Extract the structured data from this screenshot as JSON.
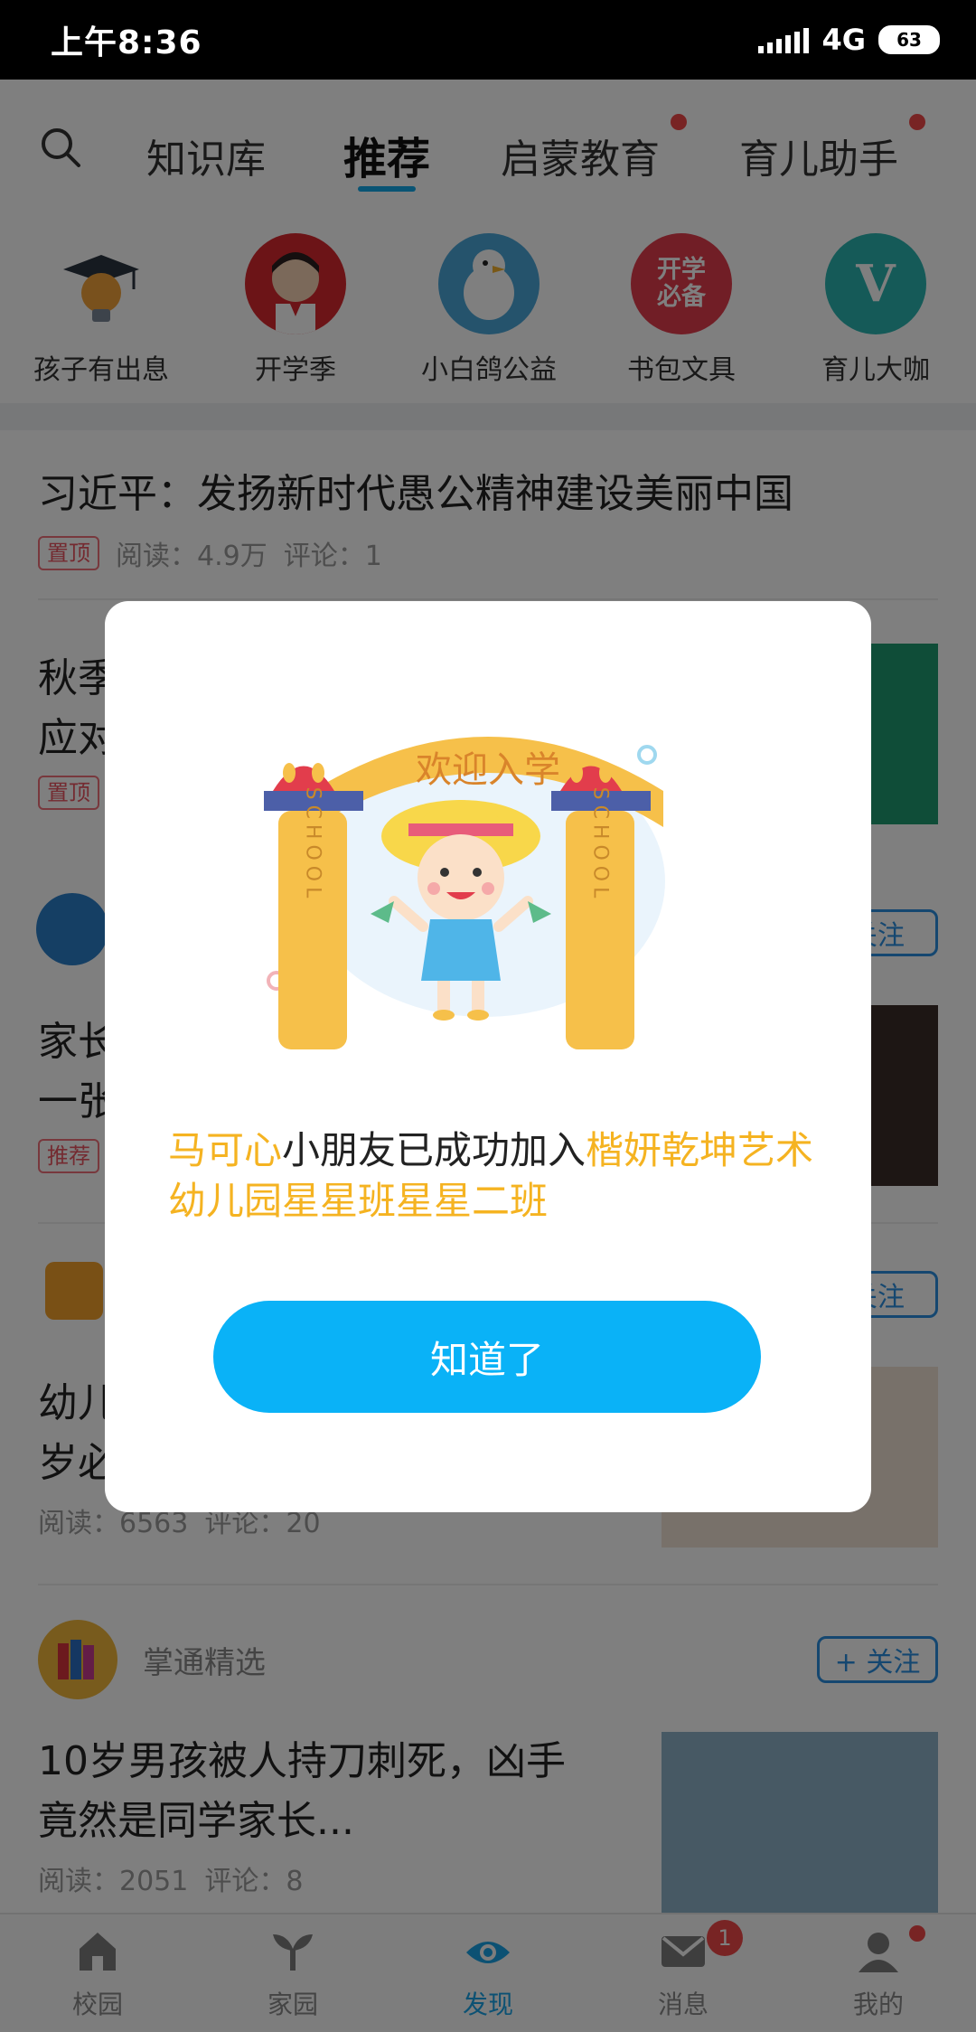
{
  "status_bar": {
    "time": "上午8:36",
    "network": "4G",
    "battery": "63"
  },
  "tabs": [
    {
      "label": "知识库",
      "active": false,
      "dot": false
    },
    {
      "label": "推荐",
      "active": true,
      "dot": false
    },
    {
      "label": "启蒙教育",
      "active": false,
      "dot": true
    },
    {
      "label": "育儿助手",
      "active": false,
      "dot": true
    }
  ],
  "categories": [
    {
      "label": "孩子有出息",
      "icon": "graduation-bulb-icon"
    },
    {
      "label": "开学季",
      "icon": "school-girl-icon"
    },
    {
      "label": "小白鸽公益",
      "icon": "white-dove-icon"
    },
    {
      "label": "书包文具",
      "icon": "back-to-school-badge-icon",
      "badge_text": "开学必备"
    },
    {
      "label": "育儿大咖",
      "icon": "v-badge-icon",
      "badge_text": "V"
    }
  ],
  "feed": {
    "article1": {
      "title": "习近平：发扬新时代愚公精神建设美丽中国",
      "tag": "置顶",
      "reads": "阅读：4.9万",
      "comments": "评论：1"
    },
    "article2": {
      "title_line1": "秋季",
      "title_line2": "应对",
      "tag": "置顶"
    },
    "article3": {
      "follow": "关注",
      "title_line1": "家长",
      "title_line2": "一张",
      "tag": "推荐"
    },
    "article4": {
      "follow": "关注",
      "title_line1": "幼儿",
      "title_line2": "岁必",
      "reads": "阅读：6563",
      "comments": "评论：20"
    },
    "article5": {
      "source": "掌通精选",
      "follow": "+ 关注",
      "title_line1": "10岁男孩被人持刀刺死，凶手",
      "title_line2": "竟然是同学家长...",
      "reads": "阅读：2051",
      "comments": "评论：8"
    }
  },
  "bottom_nav": [
    {
      "label": "校园",
      "icon": "school-icon",
      "active": false
    },
    {
      "label": "家园",
      "icon": "sprout-icon",
      "active": false
    },
    {
      "label": "发现",
      "icon": "eye-icon",
      "active": true
    },
    {
      "label": "消息",
      "icon": "mail-icon",
      "active": false,
      "badge": "1"
    },
    {
      "label": "我的",
      "icon": "user-icon",
      "active": false,
      "dot": true
    }
  ],
  "dialog": {
    "banner_text": "欢迎入学",
    "pillar_text": "SCHOOL",
    "child_name": "马可心",
    "middle_text": "小朋友已成功加入",
    "class_name": "楷妍乾坤艺术幼儿园星星班星星二班",
    "confirm_label": "知道了"
  },
  "colors": {
    "accent": "#0ab2f7",
    "highlight": "#f5b321",
    "red_dot": "#f04848",
    "follow_blue": "#2a8fe0"
  }
}
